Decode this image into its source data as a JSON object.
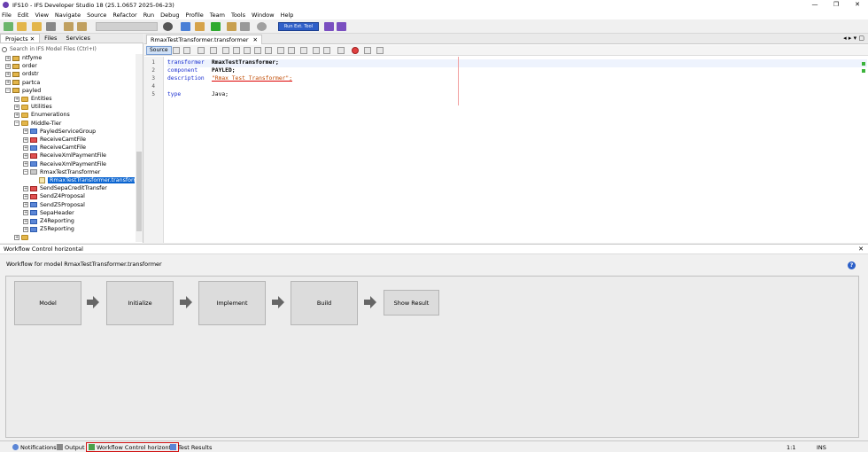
{
  "window": {
    "title": "IFS10 - IFS Developer Studio 18 (25.1.0657 2025-06-23)",
    "controls": [
      "—",
      "❐",
      "✕"
    ]
  },
  "menu": [
    "File",
    "Edit",
    "View",
    "Navigate",
    "Source",
    "Refactor",
    "Run",
    "Debug",
    "Profile",
    "Team",
    "Tools",
    "Window",
    "Help"
  ],
  "toolbar": {
    "badge_label": "Run Ext. Tool"
  },
  "left_panel": {
    "tabs": [
      "Projects",
      "Files",
      "Services"
    ],
    "close_glyph": "✕",
    "search_placeholder": "Search in IFS Model Files (Ctrl+I)",
    "tree": [
      {
        "label": "ntfyme",
        "depth": 0,
        "icon": "pkg",
        "exp": "+"
      },
      {
        "label": "order",
        "depth": 0,
        "icon": "pkg",
        "exp": "+"
      },
      {
        "label": "ordstr",
        "depth": 0,
        "icon": "pkg",
        "exp": "+"
      },
      {
        "label": "partca",
        "depth": 0,
        "icon": "pkg",
        "exp": "+"
      },
      {
        "label": "payled",
        "depth": 0,
        "icon": "pkg",
        "exp": "−"
      },
      {
        "label": "Entities",
        "depth": 1,
        "icon": "folder",
        "exp": "+"
      },
      {
        "label": "Utilities",
        "depth": 1,
        "icon": "folder",
        "exp": "+"
      },
      {
        "label": "Enumerations",
        "depth": 1,
        "icon": "folder",
        "exp": "+"
      },
      {
        "label": "Middle-Tier",
        "depth": 1,
        "icon": "folder",
        "exp": "−"
      },
      {
        "label": "PayledServiceGroup",
        "depth": 2,
        "icon": "mod-blue",
        "exp": "+"
      },
      {
        "label": "ReceiveCamtFile",
        "depth": 2,
        "icon": "mod-red",
        "exp": "+"
      },
      {
        "label": "ReceiveCamtFile",
        "depth": 2,
        "icon": "mod-blue",
        "exp": "+"
      },
      {
        "label": "ReceiveXmlPaymentFile",
        "depth": 2,
        "icon": "mod-red",
        "exp": "+"
      },
      {
        "label": "ReceiveXmlPaymentFile",
        "depth": 2,
        "icon": "mod-blue",
        "exp": "+"
      },
      {
        "label": "RmaxTestTransformer",
        "depth": 2,
        "icon": "mod-gray",
        "exp": "−"
      },
      {
        "label": "RmaxTestTransformer.transformer",
        "depth": 3,
        "icon": "file",
        "exp": "",
        "selected": true
      },
      {
        "label": "SendSepaCreditTransfer",
        "depth": 2,
        "icon": "mod-red",
        "exp": "+"
      },
      {
        "label": "SendZ4Proposal",
        "depth": 2,
        "icon": "mod-red",
        "exp": "+"
      },
      {
        "label": "SendZ5Proposal",
        "depth": 2,
        "icon": "mod-blue",
        "exp": "+"
      },
      {
        "label": "SepaHeader",
        "depth": 2,
        "icon": "mod-blue",
        "exp": "+"
      },
      {
        "label": "Z4Reporting",
        "depth": 2,
        "icon": "mod-blue",
        "exp": "+"
      },
      {
        "label": "Z5Reporting",
        "depth": 2,
        "icon": "mod-blue",
        "exp": "+"
      },
      {
        "label": "",
        "depth": 1,
        "icon": "folder",
        "exp": "+"
      }
    ]
  },
  "editor": {
    "tab_label": "RmaxTestTransformer.transformer",
    "tab_close": "✕",
    "source_button": "Source",
    "lines": [
      {
        "n": "1",
        "k": "transformer",
        "v": "RmaxTestTransformer;",
        "type": "bold"
      },
      {
        "n": "2",
        "k": "component",
        "v": "PAYLED;",
        "type": "bold"
      },
      {
        "n": "3",
        "k": "description",
        "v": "\"Rmax Test Transformer\";",
        "type": "str"
      },
      {
        "n": "4",
        "k": "",
        "v": "",
        "type": "plain"
      },
      {
        "n": "5",
        "k": "type",
        "v": "Java;",
        "type": "plain"
      }
    ]
  },
  "workflow": {
    "panel_title": "Workflow Control horizontal",
    "close_glyph": "✕",
    "subtitle": "Workflow for model RmaxTestTransformer.transformer",
    "help_glyph": "?",
    "steps": [
      "Model",
      "Initialize",
      "Implement",
      "Build",
      "Show Result"
    ]
  },
  "statusbar": {
    "tabs": [
      "Notifications",
      "Output",
      "Workflow Control horizontal",
      "Test Results"
    ],
    "position": "1:1",
    "mode": "INS"
  },
  "colors": {
    "accent_blue": "#0a64d0",
    "highlight_red": "#d01010",
    "keyword": "#1a2fd0",
    "string": "#c04a00"
  }
}
